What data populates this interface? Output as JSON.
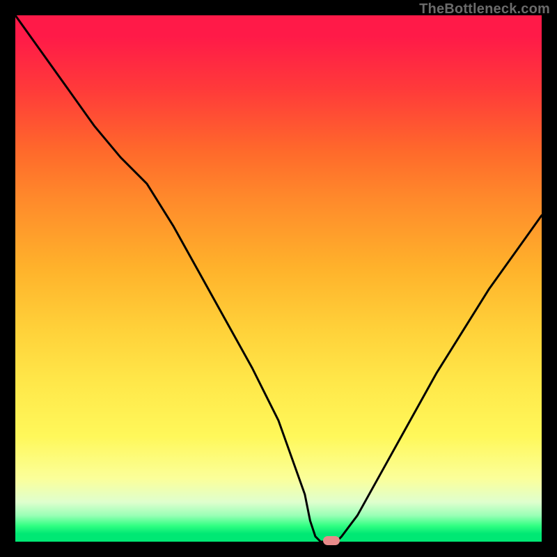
{
  "watermark": "TheBottleneck.com",
  "colors": {
    "background": "#000000",
    "gradient_top": "#ff1a48",
    "gradient_mid": "#ffd23a",
    "gradient_bottom": "#00e874",
    "curve": "#000000",
    "marker": "#e98a8a"
  },
  "chart_data": {
    "type": "line",
    "title": "",
    "xlabel": "",
    "ylabel": "",
    "xlim": [
      0,
      100
    ],
    "ylim": [
      0,
      100
    ],
    "x": [
      0,
      5,
      10,
      15,
      20,
      25,
      30,
      35,
      40,
      45,
      50,
      55,
      56,
      57,
      58,
      59,
      60,
      61,
      62,
      65,
      70,
      75,
      80,
      85,
      90,
      95,
      100
    ],
    "values": [
      100,
      93,
      86,
      79,
      73,
      68,
      60,
      51,
      42,
      33,
      23,
      9,
      4,
      1,
      0,
      0,
      0,
      0,
      1,
      5,
      14,
      23,
      32,
      40,
      48,
      55,
      62
    ],
    "marker_x": 60,
    "marker_y": 0,
    "note": "Values read in percent of plot height from bottom; x in percent of plot width."
  }
}
